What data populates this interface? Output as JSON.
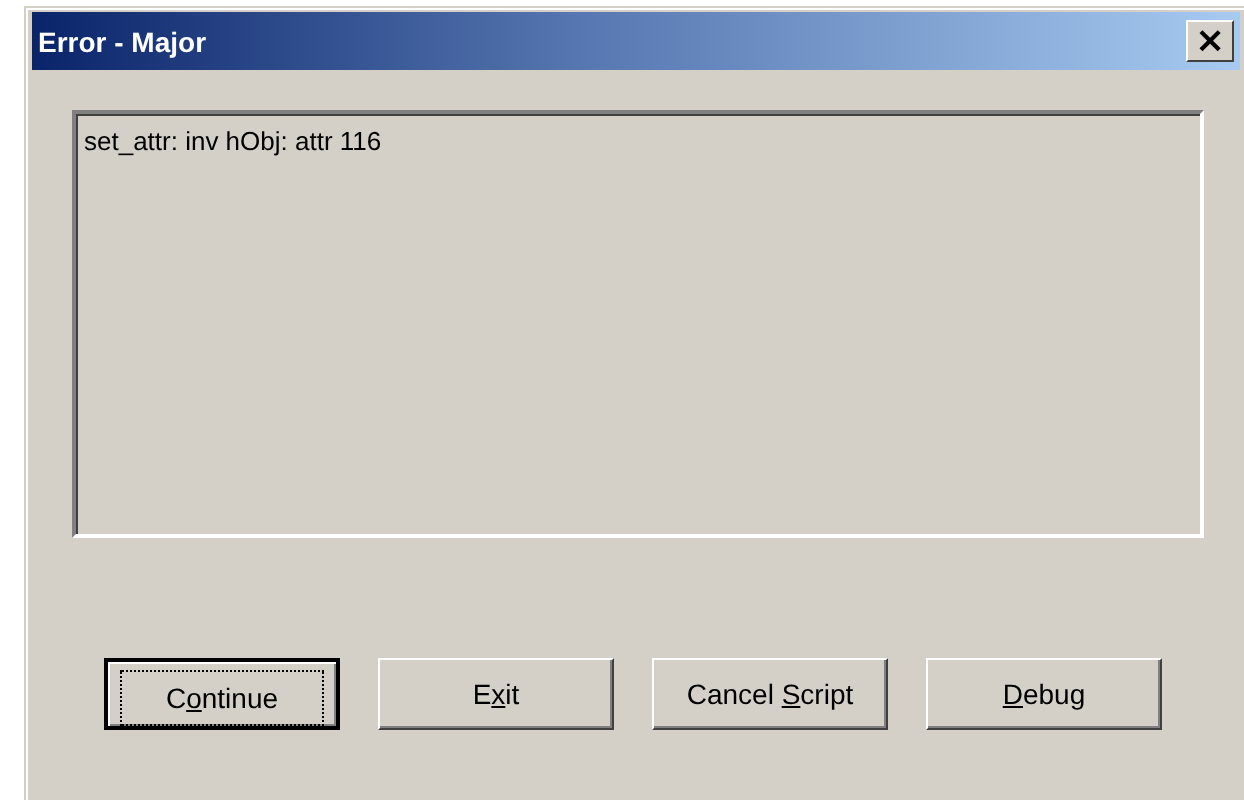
{
  "window": {
    "title": "Error - Major",
    "close": "×"
  },
  "message": "set_attr: inv hObj: attr 116",
  "buttons": [
    {
      "before": "C",
      "key": "o",
      "after": "ntinue",
      "default": true
    },
    {
      "before": "E",
      "key": "x",
      "after": "it",
      "default": false
    },
    {
      "before": "Cancel ",
      "key": "S",
      "after": "cript",
      "default": false
    },
    {
      "key": "D",
      "after": "ebug",
      "default": false
    }
  ]
}
